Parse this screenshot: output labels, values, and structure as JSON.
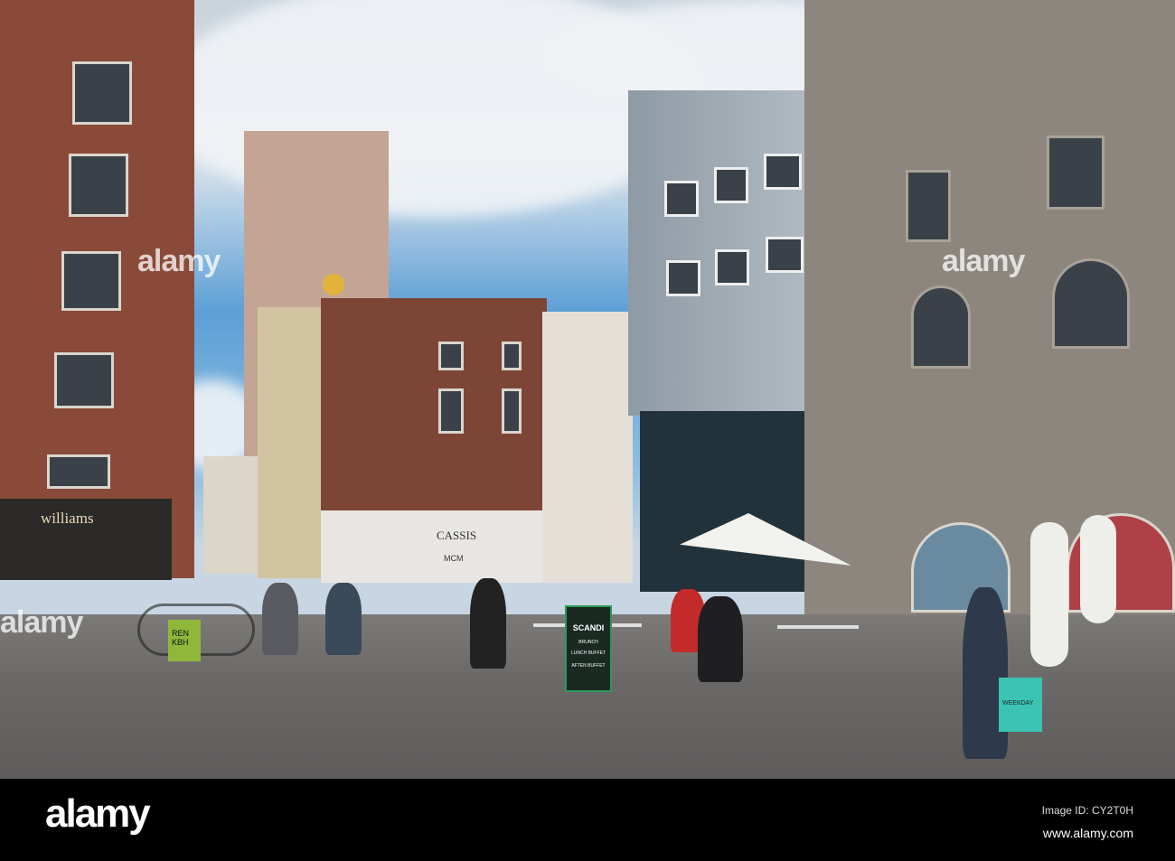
{
  "signs": {
    "shop_williams": "williams",
    "shop_cassis": "CASSIS",
    "shop_mcm": "MCM",
    "board_title": "SCANDI",
    "board_line1": "BRUNCH",
    "board_line2": "LUNCH BUFFET",
    "board_line3": "AFTEN BUFFET",
    "bin_label": "REN KBH",
    "bag_label": "WEEKDAY"
  },
  "watermark": {
    "text": "alamy"
  },
  "footer": {
    "logo": "alamy",
    "image_id": "Image ID: CY2T0H",
    "url": "www.alamy.com"
  }
}
